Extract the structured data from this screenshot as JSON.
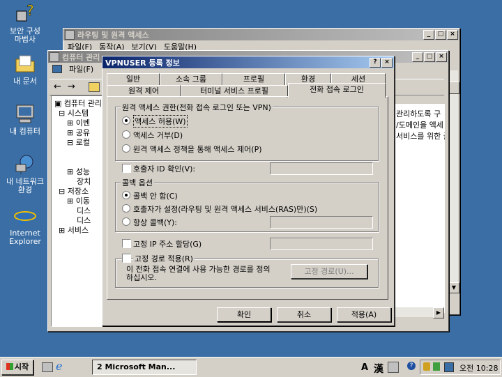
{
  "desktop": {
    "icons": [
      {
        "label_1": "보안 구성",
        "label_2": "마법사"
      },
      {
        "label_1": "내 문서"
      },
      {
        "label_1": "내 컴퓨터"
      },
      {
        "label_1": "내 네트워크",
        "label_2": "환경"
      },
      {
        "label_1": "Internet",
        "label_2": "Explorer"
      }
    ]
  },
  "back_window": {
    "title": "라우팅 및 원격 액세스",
    "menu": [
      "파일(F)",
      "동작(A)",
      "보기(V)",
      "도움말(H)"
    ]
  },
  "mid_window": {
    "title": "컴퓨터 관리",
    "menu_file": "파일(F)",
    "tree": [
      "컴퓨터 관리",
      "시스템",
      "이벤",
      "공유",
      "로컬",
      "성능",
      "장치",
      "저장소",
      "이동",
      "디스",
      "디스",
      "서비스"
    ],
    "side_text": [
      "관리하도록 구",
      "/도메인을 액세",
      "서비스를 위한 글"
    ]
  },
  "dialog": {
    "title": "VPNUSER 등록 정보",
    "tabs_row1": [
      "일반",
      "소속 그룹",
      "프로필",
      "환경",
      "세션"
    ],
    "tabs_row2": [
      "원격 제어",
      "터미널 서비스 프로필",
      "전화 접속 로그인"
    ],
    "remote_access": {
      "title": "원격 액세스 권한(전화 접속 로그인 또는 VPN)",
      "allow": "액세스 허용(W)",
      "deny": "액세스 거부(D)",
      "policy": "원격 액세스 정책을 통해 액세스 제어(P)"
    },
    "caller_id": "호출자 ID 확인(V):",
    "callback": {
      "title": "콜백 옵션",
      "none": "콜백 안 함(C)",
      "set_by_caller": "호출자가 설정(라우팅 및 원격 액세스 서비스(RAS)만)(S)",
      "always": "항상 콜백(Y):"
    },
    "static_ip": "고정 IP 주소 할당(G)",
    "static_routes": {
      "title": "고정 경로 적용(R)",
      "desc_1": "이 전화 접속 연결에 사용 가능한 경로를 정의",
      "desc_2": "하십시오.",
      "button": "고정 경로(U)..."
    },
    "buttons": {
      "ok": "확인",
      "cancel": "취소",
      "apply": "적용(A)"
    }
  },
  "taskbar": {
    "start": "시작",
    "task": "2 Microsoft Man...",
    "ime_a": "A",
    "ime_han": "漢",
    "clock": "오전 10:28"
  }
}
